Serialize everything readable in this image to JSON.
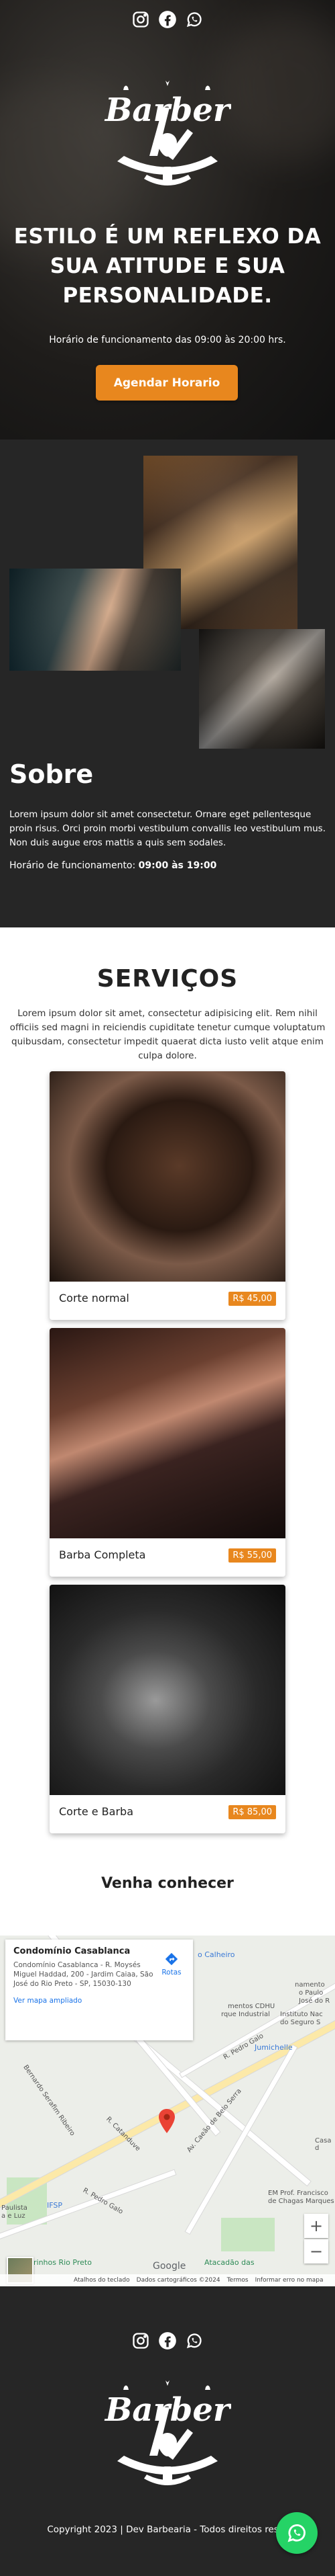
{
  "hero": {
    "logo_text": "Barber",
    "title": "ESTILO É UM REFLEXO DA SUA ATITUDE E SUA PERSONALIDADE.",
    "hours": "Horário de funcionamento das 09:00 às 20:00 hrs.",
    "cta_label": "Agendar Horario"
  },
  "social": {
    "icons": [
      "instagram-icon",
      "facebook-icon",
      "whatsapp-icon"
    ]
  },
  "about": {
    "title": "Sobre",
    "text": "Lorem ipsum dolor sit amet consectetur. Ornare eget pellentesque proin risus. Orci proin morbi vestibulum convallis leo vestibulum mus. Non duis augue eros mattis a quis sem sodales.",
    "hours_label": "Horário de funcionamento:",
    "hours_value": "09:00 às 19:00"
  },
  "services": {
    "title": "SERVIÇOS",
    "text": "Lorem ipsum dolor sit amet, consectetur adipisicing elit. Rem nihil officiis sed magni in reiciendis cupiditate tenetur cumque voluptatum quibusdam, consectetur impedit quaerat dicta iusto velit atque enim culpa dolore.",
    "items": [
      {
        "name": "Corte normal",
        "price": "R$ 45,00"
      },
      {
        "name": "Barba Completa",
        "price": "R$ 55,00"
      },
      {
        "name": "Corte e Barba",
        "price": "R$ 85,00"
      }
    ]
  },
  "location": {
    "title": "Venha conhecer",
    "map": {
      "place": "Condomínio Casablanca",
      "address": "Condomínio Casablanca - R. Moysés Miguel Haddad, 200 - Jardim Caiaa, São José do Rio Preto - SP, 15030-130",
      "larger_map": "Ver mapa ampliado",
      "directions": "Rotas",
      "labels": {
        "calheiro": "o Calheiro",
        "namento": "namento",
        "paulo": "o Paulo",
        "jose": "José do R",
        "cdhu": "mentos CDHU",
        "ndustrial": "rque Industrial",
        "instituto": "Instituto Nac",
        "seguro": "do Seguro S",
        "pedro": "R. Pedro Galo",
        "jumichelle": "Jumichelle",
        "casa": "Casa d",
        "caeao": "Av. Caeão de Belo Serra",
        "bernardo": "Bernardo Serafim Ribeiro",
        "catanduve": "R. Catanduve",
        "pedro_galo": "R. Pedro Galo",
        "em_prof": "EM Prof. Francisco",
        "chagas": "de Chagas Marques",
        "paulista": "Paulista",
        "ifsp": "IFSP",
        "maxi": "a e Luz",
        "rio_preto": "rinhos Rio Preto",
        "atacadao": "Atacadão das",
        "google": "Google",
        "shortcuts": "Atalhos do teclado",
        "mapdata": "Dados cartográficos ©2024",
        "terms": "Termos",
        "report": "Informar erro no mapa"
      }
    }
  },
  "footer": {
    "logo_text": "Barber",
    "copyright": "Copyright 2023 | Dev Barbearia - Todos direitos reser"
  },
  "colors": {
    "accent": "#e8871e",
    "dark": "#262626",
    "whatsapp": "#25d366"
  }
}
